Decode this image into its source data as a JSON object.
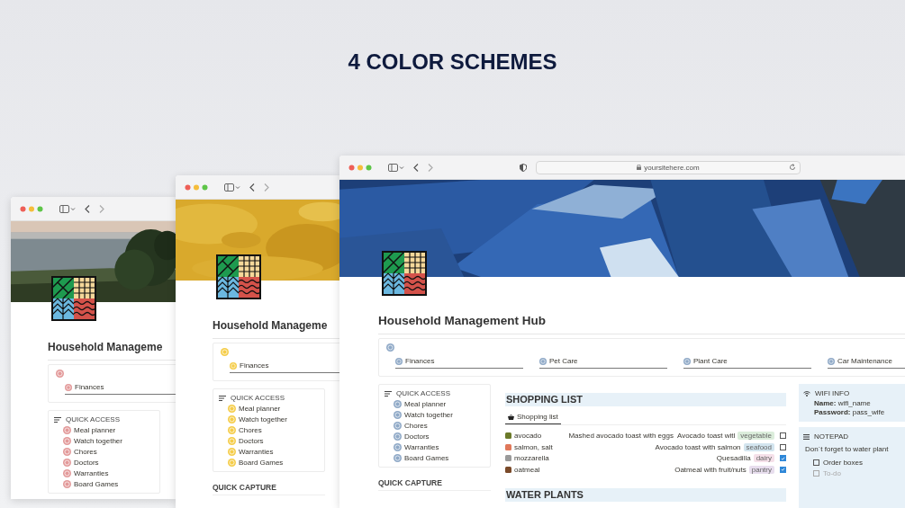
{
  "headline": "4 COLOR SCHEMES",
  "windows": [
    {
      "color": "#e39a9a",
      "cover": {
        "kind": "picture"
      },
      "title": "Household Manageme",
      "links": [
        "Finances"
      ],
      "quick_access": {
        "heading": "QUICK ACCESS",
        "items": [
          "Meal planner",
          "Watch together",
          "Chores",
          "Doctors",
          "Warranties",
          "Board Games"
        ]
      }
    },
    {
      "color": "#f5cd4a",
      "cover": {
        "kind": "picture"
      },
      "title": "Household Manageme",
      "links": [
        "Finances"
      ],
      "quick_access": {
        "heading": "QUICK ACCESS",
        "items": [
          "Meal planner",
          "Watch together",
          "Chores",
          "Doctors",
          "Warranties",
          "Board Games"
        ]
      },
      "quick_capture": "QUICK CAPTURE"
    },
    {
      "color": "#8fa9c7",
      "url": "yoursitehere.com",
      "cover": {
        "kind": "picture"
      },
      "title": "Household Management Hub",
      "links": [
        "Finances",
        "Pet Care",
        "Plant Care",
        "Car Maintenance"
      ],
      "quick_access": {
        "heading": "QUICK ACCESS",
        "items": [
          "Meal planner",
          "Watch together",
          "Chores",
          "Doctors",
          "Warranties",
          "Board Games"
        ]
      },
      "quick_capture": "QUICK CAPTURE",
      "shopping": {
        "heading": "SHOPPING LIST",
        "tab": "Shopping list",
        "rows": [
          {
            "item": "avocado",
            "recipes": [
              "Mashed avocado toast with eggs",
              "Avocado toast witl"
            ],
            "tag": "vegetable",
            "color": "#dbeddb",
            "checked": false
          },
          {
            "item": "salmon, salt",
            "recipes": [
              "Avocado toast with salmon"
            ],
            "tag": "seafood",
            "color": "#d3e5ef",
            "checked": false
          },
          {
            "item": "mozzarella",
            "recipes": [
              "Quesadilla"
            ],
            "tag": "dairy",
            "color": "#f5e0e9",
            "checked": true
          },
          {
            "item": "oatmeal",
            "recipes": [
              "Oatmeal with fruit/nuts"
            ],
            "tag": "pantry",
            "color": "#e8deee",
            "checked": true
          }
        ]
      },
      "next_heading": "WATER PLANTS",
      "wifi": {
        "heading": "WIFI INFO",
        "lines": [
          {
            "label": "Name:",
            "value": "wifi_name"
          },
          {
            "label": "Password:",
            "value": "pass_wife"
          }
        ]
      },
      "notepad": {
        "heading": "NOTEPAD",
        "text": "Don´t forget to water plant",
        "todos": [
          {
            "label": "Order boxes",
            "checked": false,
            "disabled": false
          },
          {
            "label": "To-do",
            "checked": false,
            "disabled": true
          }
        ]
      }
    }
  ]
}
